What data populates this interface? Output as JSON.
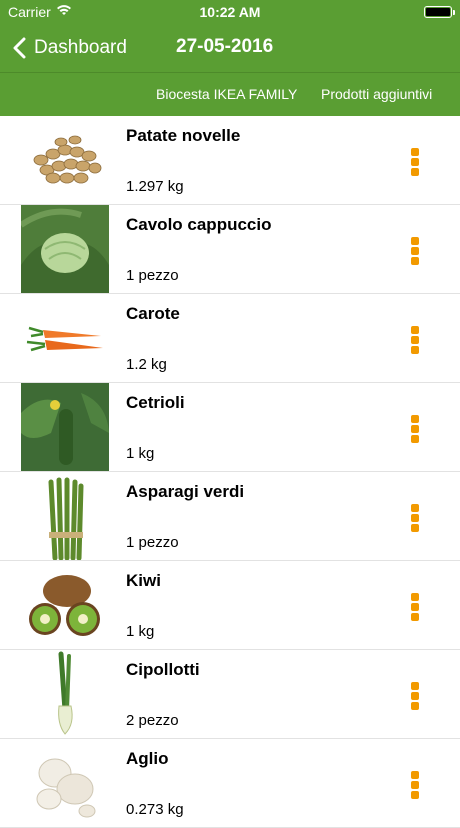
{
  "status_bar": {
    "carrier": "Carrier",
    "time": "10:22 AM"
  },
  "nav": {
    "back_label": "Dashboard",
    "title": "27-05-2016"
  },
  "tabs": [
    "Biocesta IKEA FAMILY",
    "Prodotti aggiuntivi"
  ],
  "colors": {
    "header": "#5a9e33",
    "menu_dots": "#f29a00"
  },
  "items": [
    {
      "name": "Patate novelle",
      "quantity": "1.297 kg",
      "icon": "potatoes-image"
    },
    {
      "name": "Cavolo cappuccio",
      "quantity": "1 pezzo",
      "icon": "cabbage-image"
    },
    {
      "name": "Carote",
      "quantity": "1.2 kg",
      "icon": "carrots-image"
    },
    {
      "name": "Cetrioli",
      "quantity": "1 kg",
      "icon": "cucumber-image"
    },
    {
      "name": "Asparagi verdi",
      "quantity": "1 pezzo",
      "icon": "asparagus-image"
    },
    {
      "name": "Kiwi",
      "quantity": "1 kg",
      "icon": "kiwi-image"
    },
    {
      "name": "Cipollotti",
      "quantity": "2 pezzo",
      "icon": "spring-onion-image"
    },
    {
      "name": "Aglio",
      "quantity": "0.273 kg",
      "icon": "garlic-image"
    }
  ]
}
